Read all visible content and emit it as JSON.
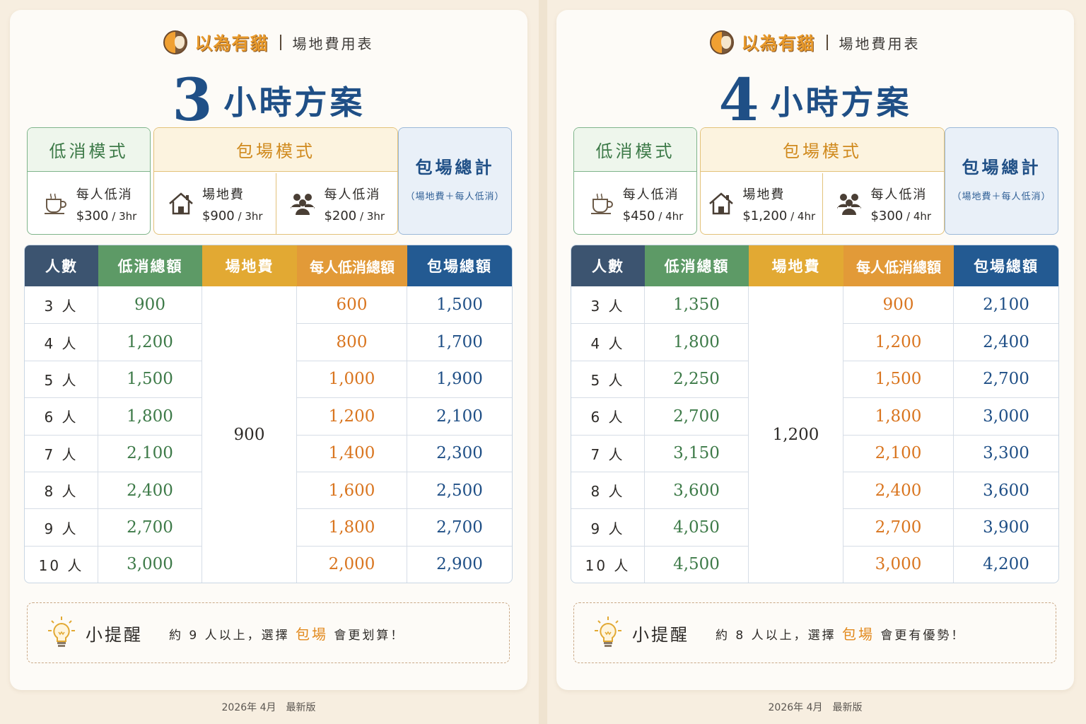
{
  "brand": {
    "name": "以為有貓",
    "subtitle": "場地費用表"
  },
  "footer_text": "2026年 4月　最新版",
  "tip_title": "小提醒",
  "colors": {
    "navy": "#1f4f86",
    "green": "#5d9a66",
    "gold": "#e2a933",
    "orange": "#e29a38",
    "blue": "#235a92",
    "slate": "#3c5470"
  },
  "headers": {
    "people": "人數",
    "min_total": "低消總額",
    "venue": "場地費",
    "per_person_total": "每人低消總額",
    "package_total": "包場總額"
  },
  "modes": {
    "low": "低消模式",
    "pkg": "包場模式",
    "total": "包場總計",
    "total_note": "（場地費＋每人低消）",
    "per_person_label": "每人低消",
    "venue_label": "場地費"
  },
  "plans": [
    {
      "num": "3",
      "title": "小時方案",
      "low_price": "$300",
      "low_unit": " / 3hr",
      "venue_price": "$900",
      "venue_unit": " / 3hr",
      "pp_price": "$200",
      "pp_unit": " / 3hr",
      "venue_fee": "900",
      "rows": [
        [
          "3 人",
          "900",
          "600",
          "1,500"
        ],
        [
          "4 人",
          "1,200",
          "800",
          "1,700"
        ],
        [
          "5 人",
          "1,500",
          "1,000",
          "1,900"
        ],
        [
          "6 人",
          "1,800",
          "1,200",
          "2,100"
        ],
        [
          "7 人",
          "2,100",
          "1,400",
          "2,300"
        ],
        [
          "8 人",
          "2,400",
          "1,600",
          "2,500"
        ],
        [
          "9 人",
          "2,700",
          "1,800",
          "2,700"
        ],
        [
          "10 人",
          "3,000",
          "2,000",
          "2,900"
        ]
      ],
      "tip_pre": "約 9 人以上，選擇 ",
      "tip_hl": "包場",
      "tip_post": " 會更划算！"
    },
    {
      "num": "4",
      "title": "小時方案",
      "low_price": "$450",
      "low_unit": " / 4hr",
      "venue_price": "$1,200",
      "venue_unit": " / 4hr",
      "pp_price": "$300",
      "pp_unit": " / 4hr",
      "venue_fee": "1,200",
      "rows": [
        [
          "3 人",
          "1,350",
          "900",
          "2,100"
        ],
        [
          "4 人",
          "1,800",
          "1,200",
          "2,400"
        ],
        [
          "5 人",
          "2,250",
          "1,500",
          "2,700"
        ],
        [
          "6 人",
          "2,700",
          "1,800",
          "3,000"
        ],
        [
          "7 人",
          "3,150",
          "2,100",
          "3,300"
        ],
        [
          "8 人",
          "3,600",
          "2,400",
          "3,600"
        ],
        [
          "9 人",
          "4,050",
          "2,700",
          "3,900"
        ],
        [
          "10 人",
          "4,500",
          "3,000",
          "4,200"
        ]
      ],
      "tip_pre": "約 8 人以上，選擇 ",
      "tip_hl": "包場",
      "tip_post": " 會更有優勢！"
    }
  ]
}
